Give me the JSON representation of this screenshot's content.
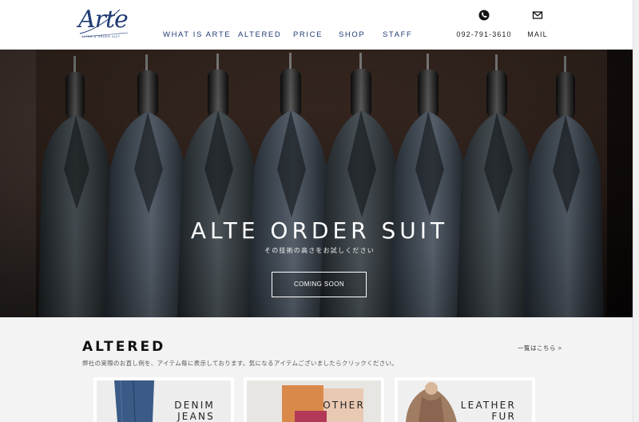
{
  "header": {
    "logo": {
      "word": "Arte",
      "tagline": "ALTER & ORDER SUIT"
    },
    "nav": [
      {
        "label": "WHAT IS ARTE"
      },
      {
        "label": "ALTERED"
      },
      {
        "label": "PRICE"
      },
      {
        "label": "SHOP"
      },
      {
        "label": "STAFF"
      }
    ],
    "phone": {
      "icon": "phone-icon",
      "label": "092-791-3610"
    },
    "mail": {
      "icon": "mail-icon",
      "label": "MAIL"
    },
    "colors": {
      "brand": "#1f3b73"
    }
  },
  "hero": {
    "title": "ALTE ORDER SUIT",
    "subtitle": "その技術の高さをお試しください",
    "button": "COMING SOON"
  },
  "altered": {
    "title": "ALTERED",
    "link": "一覧はこちら >",
    "description": "弊社の実際のお直し例を、アイテム毎に表示しております。気になるアイテムございましたらクリックください。",
    "cards": [
      {
        "title": "DENIM\nJEANS"
      },
      {
        "title": "OTHER"
      },
      {
        "title": "LEATHER\nFUR\nDOWN"
      }
    ]
  }
}
